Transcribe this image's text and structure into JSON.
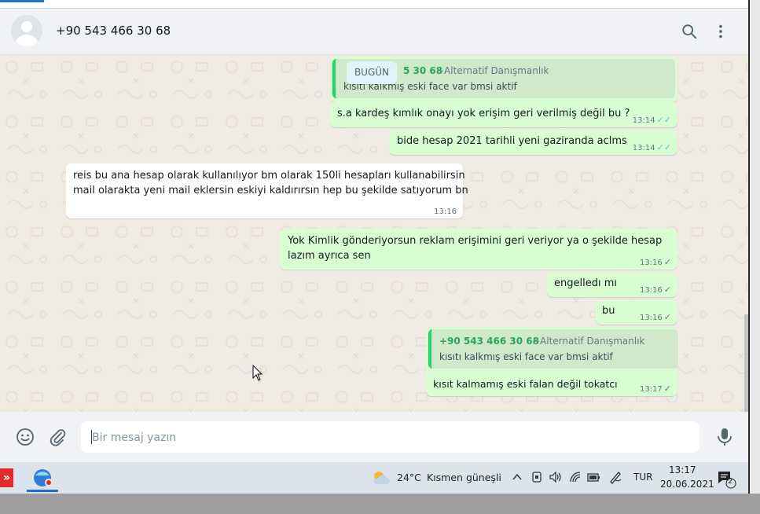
{
  "header": {
    "contact_name": "+90 543 466 30 68",
    "icons": [
      "avatar-default-icon",
      "search-icon",
      "menu-dots-icon"
    ]
  },
  "chat": {
    "day_chip": "BUGÜN",
    "messages": [
      {
        "direction": "out",
        "quoted": {
          "name_fragment": "5 30 68",
          "note": "~Alternatif Danışmanlık",
          "text_fragment": "kısıtı kalkmış eski face var bmsi aktif"
        }
      },
      {
        "direction": "out",
        "text": "s.a kardeş kımlık onayı yok erişim geri verilmiş değil bu ?",
        "time": "13:14",
        "status": "read"
      },
      {
        "direction": "out",
        "text": "bide hesap 2021 tarihli yeni gaziranda aclms",
        "time": "13:14",
        "status": "read"
      },
      {
        "direction": "in",
        "line1": "reis bu ana hesap olarak kullanılıyor bm olarak 150li hesapları kullanabilirsin",
        "line2": "mail olarakta yeni mail eklersin eskiyi kaldırırsın hep bu şekilde satıyorum bn",
        "time": "13:16"
      },
      {
        "direction": "out",
        "line1": "Yok Kimlik gönderiyorsun reklam erişimini geri veriyor ya o şekilde hesap",
        "line2": "lazım ayrıca sen",
        "time": "13:16",
        "status": "sent"
      },
      {
        "direction": "out",
        "text": "engelledı mı",
        "time": "13:16",
        "status": "sent"
      },
      {
        "direction": "out",
        "text": "bu",
        "time": "13:16",
        "status": "sent"
      },
      {
        "direction": "out",
        "quoted": {
          "name": "+90 543 466 30 68",
          "note": "~Alternatif Danışmanlık",
          "text": "kısıtı kalkmış eski face var bmsi aktif"
        },
        "text": "kısıt kalmamış eski falan değil tokatcı",
        "time": "13:17",
        "status": "sent"
      }
    ]
  },
  "composer": {
    "placeholder": "Bir mesaj yazın",
    "icons": [
      "emoji-icon",
      "attach-icon",
      "microphone-icon"
    ]
  },
  "taskbar": {
    "weather_temp": "24°C",
    "weather_desc": "Kısmen güneşli",
    "language": "TUR",
    "time": "13:17",
    "date": "20.06.2021",
    "notification_count": "2",
    "icons": [
      "anydesk-icon",
      "browser-app-icon",
      "weather-sun-cloud-icon",
      "chevron-up-icon",
      "meet-now-icon",
      "volume-icon",
      "wifi-icon",
      "battery-icon",
      "pen-icon",
      "notification-icon"
    ]
  },
  "colors": {
    "outgoing": "#d9fdd3",
    "incoming": "#ffffff",
    "chat_bg": "#efeae2",
    "read_tick": "#53bdeb",
    "quote_name": "#25a85c"
  }
}
